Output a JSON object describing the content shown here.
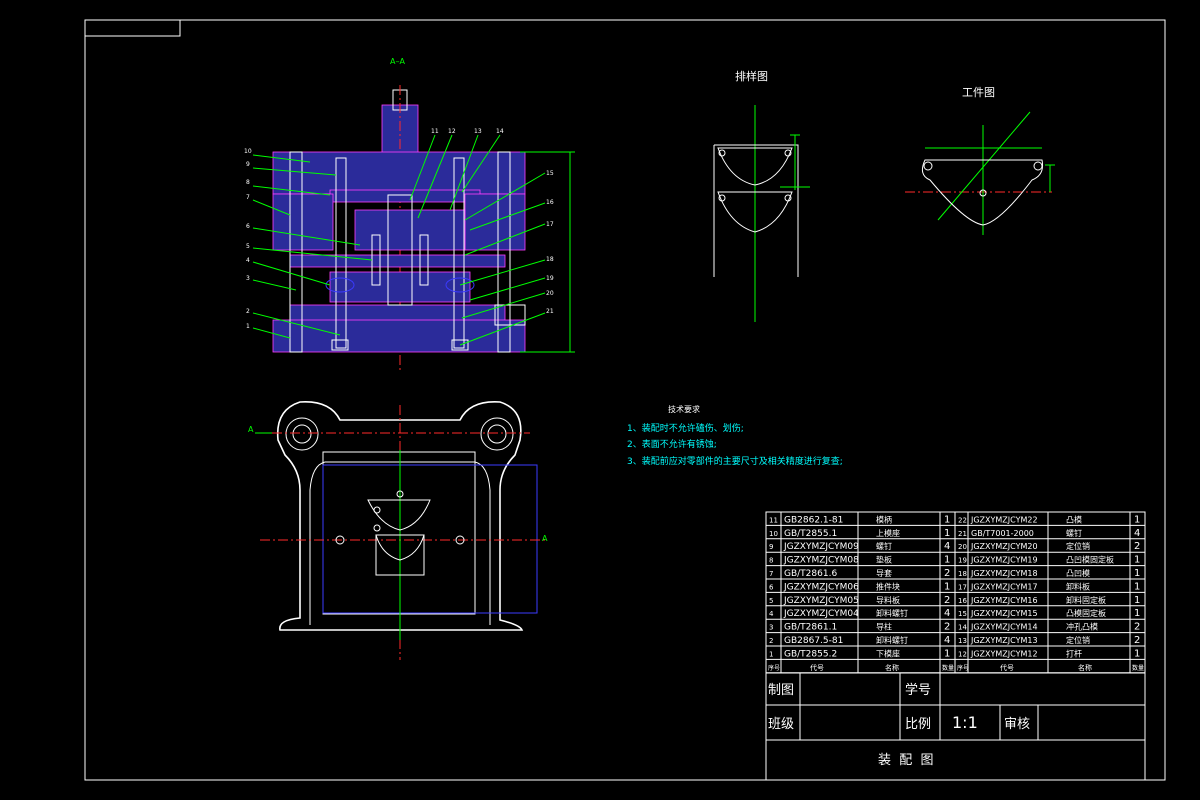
{
  "section_label": "A–A",
  "layout_title": "排样图",
  "part_title": "工件图",
  "cut_marks": {
    "left": "A",
    "right": "A"
  },
  "tech": {
    "heading": "技术要求",
    "items": [
      "1、装配时不允许磕伤、划伤;",
      "2、表面不允许有锈蚀;",
      "3、装配前应对零部件的主要尺寸及相关精度进行复查;"
    ]
  },
  "callouts_left": [
    "10",
    "9",
    "8",
    "7",
    "6",
    "5",
    "4",
    "3",
    "2",
    "1"
  ],
  "callouts_top": [
    "11",
    "12",
    "13",
    "14"
  ],
  "callouts_right": [
    "15",
    "16",
    "17",
    "18",
    "19",
    "20",
    "21"
  ],
  "bom_left": [
    {
      "no": "11",
      "code": "GB2862.1-81",
      "name": "模柄",
      "qty": "1"
    },
    {
      "no": "10",
      "code": "GB/T2855.1",
      "name": "上模座",
      "qty": "1"
    },
    {
      "no": "9",
      "code": "JGZXYMZJCYM09",
      "name": "螺钉",
      "qty": "4"
    },
    {
      "no": "8",
      "code": "JGZXYMZJCYM08",
      "name": "垫板",
      "qty": "1"
    },
    {
      "no": "7",
      "code": "GB/T2861.6",
      "name": "导套",
      "qty": "2"
    },
    {
      "no": "6",
      "code": "JGZXYMZJCYM06",
      "name": "推件块",
      "qty": "1"
    },
    {
      "no": "5",
      "code": "JGZXYMZJCYM05",
      "name": "导料板",
      "qty": "2"
    },
    {
      "no": "4",
      "code": "JGZXYMZJCYM04",
      "name": "卸料螺钉",
      "qty": "4"
    },
    {
      "no": "3",
      "code": "GB/T2861.1",
      "name": "导柱",
      "qty": "2"
    },
    {
      "no": "2",
      "code": "GB2867.5-81",
      "name": "卸料螺钉",
      "qty": "4"
    },
    {
      "no": "1",
      "code": "GB/T2855.2",
      "name": "下模座",
      "qty": "1"
    }
  ],
  "bom_right": [
    {
      "no": "22",
      "code": "JGZXYMZJCYM22",
      "name": "凸模",
      "qty": "1"
    },
    {
      "no": "21",
      "code": "GB/T7001-2000",
      "name": "螺钉",
      "qty": "4"
    },
    {
      "no": "20",
      "code": "JGZXYMZJCYM20",
      "name": "定位销",
      "qty": "2"
    },
    {
      "no": "19",
      "code": "JGZXYMZJCYM19",
      "name": "凸凹模固定板",
      "qty": "1"
    },
    {
      "no": "18",
      "code": "JGZXYMZJCYM18",
      "name": "凸凹模",
      "qty": "1"
    },
    {
      "no": "17",
      "code": "JGZXYMZJCYM17",
      "name": "卸料板",
      "qty": "1"
    },
    {
      "no": "16",
      "code": "JGZXYMZJCYM16",
      "name": "卸料固定板",
      "qty": "1"
    },
    {
      "no": "15",
      "code": "JGZXYMZJCYM15",
      "name": "凸模固定板",
      "qty": "1"
    },
    {
      "no": "14",
      "code": "JGZXYMZJCYM14",
      "name": "冲孔凸模",
      "qty": "2"
    },
    {
      "no": "13",
      "code": "JGZXYMZJCYM13",
      "name": "定位销",
      "qty": "2"
    },
    {
      "no": "12",
      "code": "JGZXYMZJCYM12",
      "name": "打杆",
      "qty": "1"
    }
  ],
  "bom_header": {
    "seq": "序号",
    "code": "代号",
    "name": "名称",
    "qty": "数量"
  },
  "title_block": {
    "drawn_label": "制图",
    "student_no_label": "学号",
    "class_label": "班级",
    "scale_label": "比例",
    "scale_value": "1:1",
    "check_label": "审核",
    "drawing_title": "装  配  图"
  },
  "colors": {
    "line": "#ffffff",
    "accent": "#00ff00",
    "center": "#ff2a2a",
    "hidden": "#3b3bff",
    "hatch": "#2b2b9a"
  }
}
